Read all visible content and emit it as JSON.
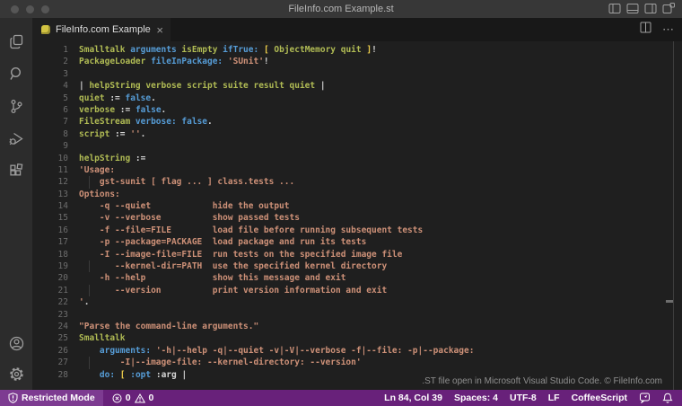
{
  "window": {
    "title": "FileInfo.com Example.st",
    "controls": [
      "close",
      "minimize",
      "zoom"
    ]
  },
  "titlebar_icons": [
    "toggle-primary-sidebar",
    "toggle-panel",
    "toggle-secondary-sidebar",
    "customize-layout"
  ],
  "activity_bar": [
    "explorer",
    "search",
    "source-control",
    "run-and-debug",
    "extensions",
    "account",
    "settings"
  ],
  "tab": {
    "label": "FileInfo.com Example.st",
    "close": "×",
    "file_icon": "smalltalk-file-icon"
  },
  "editor_actions": {
    "split": "split-editor",
    "more": "⋯"
  },
  "editor": {
    "language_note": "Smalltalk source shown, detected as CoffeeScript",
    "lines": [
      {
        "n": "1",
        "t": [
          [
            "g",
            "Smalltalk "
          ],
          [
            "b",
            "arguments "
          ],
          [
            "g",
            "isEmpty "
          ],
          [
            "b",
            "ifTrue: "
          ],
          [
            "y",
            "[ "
          ],
          [
            "g",
            "ObjectMemory quit "
          ],
          [
            "y",
            "]"
          ],
          [
            "w",
            "!"
          ]
        ]
      },
      {
        "n": "2",
        "t": [
          [
            "g",
            "PackageLoader "
          ],
          [
            "b",
            "fileInPackage: "
          ],
          [
            "s",
            "'SUnit'"
          ],
          [
            "w",
            "!"
          ]
        ]
      },
      {
        "n": "3",
        "t": []
      },
      {
        "n": "4",
        "t": [
          [
            "w",
            "| "
          ],
          [
            "g",
            "helpString verbose script suite result quiet "
          ],
          [
            "w",
            "|"
          ]
        ]
      },
      {
        "n": "5",
        "t": [
          [
            "g",
            "quiet "
          ],
          [
            "w",
            ":= "
          ],
          [
            "b",
            "false"
          ],
          [
            "w",
            "."
          ]
        ]
      },
      {
        "n": "6",
        "t": [
          [
            "g",
            "verbose "
          ],
          [
            "w",
            ":= "
          ],
          [
            "b",
            "false"
          ],
          [
            "w",
            "."
          ]
        ]
      },
      {
        "n": "7",
        "t": [
          [
            "g",
            "FileStream "
          ],
          [
            "b",
            "verbose: "
          ],
          [
            "b",
            "false"
          ],
          [
            "w",
            "."
          ]
        ]
      },
      {
        "n": "8",
        "t": [
          [
            "g",
            "script "
          ],
          [
            "w",
            ":= "
          ],
          [
            "s",
            "''"
          ],
          [
            "w",
            "."
          ]
        ]
      },
      {
        "n": "9",
        "t": []
      },
      {
        "n": "10",
        "t": [
          [
            "g",
            "helpString "
          ],
          [
            "w",
            ":="
          ]
        ]
      },
      {
        "n": "11",
        "t": [
          [
            "s",
            "'Usage:"
          ]
        ]
      },
      {
        "n": "12",
        "t": [
          [
            "s",
            "    gst-sunit [ flag ... ] class.tests ..."
          ]
        ],
        "g": [
          4
        ]
      },
      {
        "n": "13",
        "t": [
          [
            "s",
            "Options:"
          ]
        ]
      },
      {
        "n": "14",
        "t": [
          [
            "s",
            "    -q --quiet            hide the output"
          ]
        ]
      },
      {
        "n": "15",
        "t": [
          [
            "s",
            "    -v --verbose          show passed tests"
          ]
        ]
      },
      {
        "n": "16",
        "t": [
          [
            "s",
            "    -f --file=FILE        load file before running subsequent tests"
          ]
        ]
      },
      {
        "n": "17",
        "t": [
          [
            "s",
            "    -p --package=PACKAGE  load package and run its tests"
          ]
        ]
      },
      {
        "n": "18",
        "t": [
          [
            "s",
            "    -I --image-file=FILE  run tests on the specified image file"
          ]
        ]
      },
      {
        "n": "19",
        "t": [
          [
            "s",
            "       --kernel-dir=PATH  use the specified kernel directory"
          ]
        ],
        "g": [
          4
        ]
      },
      {
        "n": "20",
        "t": [
          [
            "s",
            "    -h --help             show this message and exit"
          ]
        ]
      },
      {
        "n": "21",
        "t": [
          [
            "s",
            "       --version          print version information and exit"
          ]
        ],
        "g": [
          4
        ]
      },
      {
        "n": "22",
        "t": [
          [
            "s",
            "'"
          ],
          [
            "w",
            "."
          ]
        ]
      },
      {
        "n": "23",
        "t": []
      },
      {
        "n": "24",
        "t": [
          [
            "s",
            "\"Parse the command-line arguments.\""
          ]
        ]
      },
      {
        "n": "25",
        "t": [
          [
            "g",
            "Smalltalk"
          ]
        ]
      },
      {
        "n": "26",
        "t": [
          [
            "w",
            "    "
          ],
          [
            "b",
            "arguments: "
          ],
          [
            "s",
            "'-h|--help -q|--quiet -v|-V|--verbose -f|--file: -p|--package:"
          ]
        ]
      },
      {
        "n": "27",
        "t": [
          [
            "s",
            "        -I|--image-file: --kernel-directory: --version'"
          ]
        ],
        "g": [
          4
        ]
      },
      {
        "n": "28",
        "t": [
          [
            "w",
            "    "
          ],
          [
            "b",
            "do: "
          ],
          [
            "y",
            "[ "
          ],
          [
            "b",
            ":opt "
          ],
          [
            "w",
            ":arg |"
          ]
        ]
      }
    ]
  },
  "footer_note": ".ST file open in Microsoft Visual Studio Code. © FileInfo.com",
  "status_bar": {
    "restricted_mode": "Restricted Mode",
    "errors": "0",
    "warnings": "0",
    "cursor": "Ln 84, Col 39",
    "indentation": "Spaces: 4",
    "encoding": "UTF-8",
    "eol": "LF",
    "language": "CoffeeScript"
  },
  "colors": {
    "status_bar_bg": "#68217a",
    "restricted_badge_bg": "#7d3b91",
    "titlebar_bg": "#373737",
    "tabbar_bg": "#181818",
    "activitybar_bg": "#2c2c2c",
    "editor_bg": "#1f1f1f",
    "syntax": {
      "identifier": "#b0bb54",
      "keyword": "#569cd6",
      "string": "#ce9178",
      "bracket": "#eece4a",
      "plain": "#d6d6d6"
    }
  }
}
